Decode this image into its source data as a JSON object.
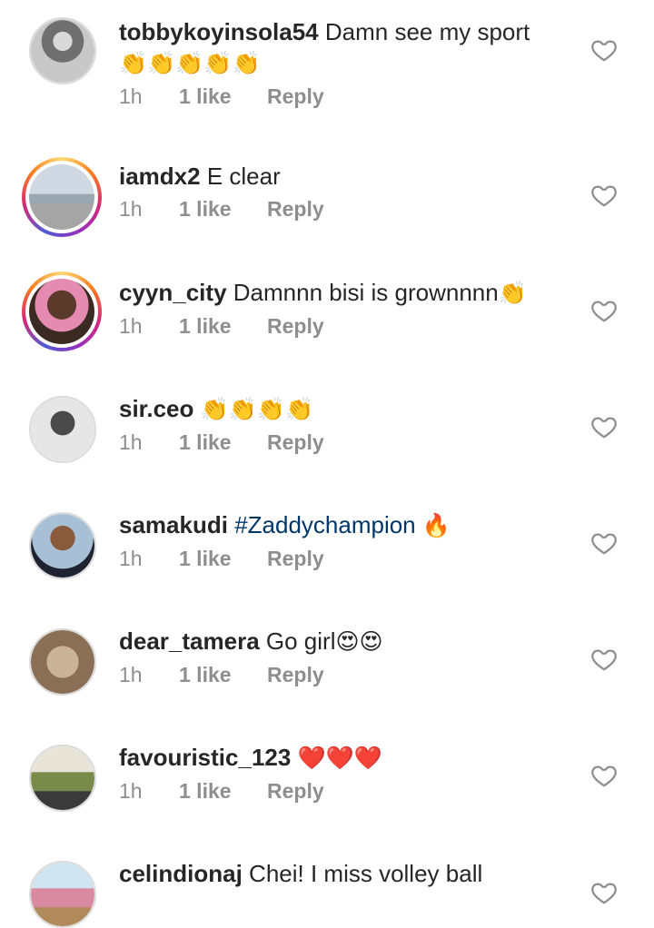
{
  "comments": [
    {
      "username": "tobbykoyinsola54",
      "text": "Damn see my sport",
      "emojis": "👏👏👏👏👏",
      "time": "1h",
      "likes": "1 like",
      "reply": "Reply",
      "story": false
    },
    {
      "username": "iamdx2",
      "text": "E clear",
      "emojis": "",
      "time": "1h",
      "likes": "1 like",
      "reply": "Reply",
      "story": true
    },
    {
      "username": "cyyn_city",
      "text": "Damnnn bisi is grownnnn",
      "emojis": "👏",
      "time": "1h",
      "likes": "1 like",
      "reply": "Reply",
      "story": true
    },
    {
      "username": "sir.ceo",
      "text": "",
      "emojis": "👏👏👏👏",
      "time": "1h",
      "likes": "1 like",
      "reply": "Reply",
      "story": false
    },
    {
      "username": "samakudi",
      "text": "#Zaddychampion",
      "emojis": "🔥",
      "time": "1h",
      "likes": "1 like",
      "reply": "Reply",
      "story": false
    },
    {
      "username": "dear_tamera",
      "text": "Go girl",
      "emojis": "😍😍",
      "time": "1h",
      "likes": "1 like",
      "reply": "Reply",
      "story": false
    },
    {
      "username": "favouristic_123",
      "text": "",
      "emojis": "❤️❤️❤️",
      "time": "1h",
      "likes": "1 like",
      "reply": "Reply",
      "story": false
    },
    {
      "username": "celindionaj",
      "text": "Chei! I miss volley ball",
      "emojis": "",
      "time": "",
      "likes": "",
      "reply": "",
      "story": false
    }
  ],
  "colors": {
    "hashtag": "#00376b",
    "meta": "#8e8e8e",
    "text": "#262626"
  },
  "icons": {
    "like": "heart-outline-icon"
  }
}
